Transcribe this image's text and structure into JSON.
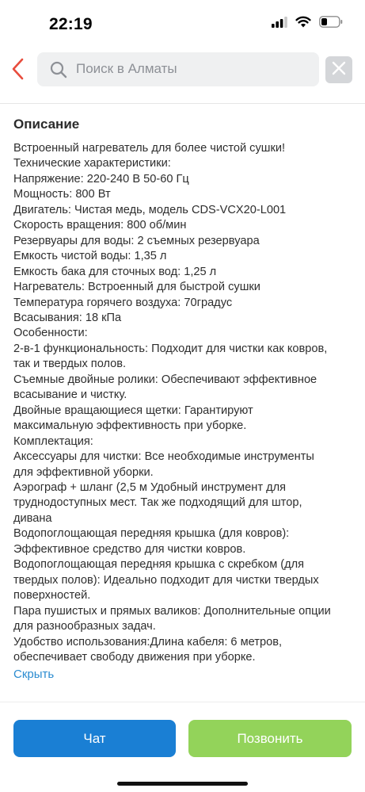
{
  "status_bar": {
    "time": "22:19"
  },
  "header": {
    "search_placeholder": "Поиск в Алматы"
  },
  "description": {
    "title": "Описание",
    "lines": [
      "Встроенный нагреватель для более чистой сушки!",
      "Технические характеристики:",
      "Напряжение: 220-240 В 50-60 Гц",
      "Мощность: 800 Вт",
      "Двигатель: Чистая медь, модель CDS-VCX20-L001",
      "Скорость вращения: 800 об/мин",
      "Резервуары для воды: 2 съемных резервуара",
      "Емкость чистой воды: 1,35 л",
      "Емкость бака для сточных вод: 1,25 л",
      "Нагреватель: Встроенный для быстрой сушки",
      "Температура горячего воздуха: 70градус",
      "Всасывания: 18 кПа",
      "Особенности:",
      "2-в-1 функциональность: Подходит для чистки как ковров,",
      "так и твердых полов.",
      "Съемные двойные ролики: Обеспечивают эффективное",
      "всасывание и чистку.",
      "Двойные вращающиеся щетки: Гарантируют",
      "максимальную эффективность при уборке.",
      "Комплектация:",
      "Аксессуары для чистки: Все необходимые инструменты",
      "для эффективной уборки.",
      "Аэрограф + шланг (2,5 м Удобный инструмент для",
      "труднодоступных мест. Так же подходящий для штор,",
      "дивана",
      "Водопоглощающая передняя крышка (для ковров):",
      "Эффективное средство для чистки ковров.",
      "Водопоглощающая передняя крышка с скребком (для",
      "твердых полов): Идеально подходит для чистки твердых",
      "поверхностей.",
      "Пара пушистых и прямых валиков: Дополнительные опции",
      "для разнообразных задач.",
      "Удобство использования:Длина кабеля: 6 метров,",
      "обеспечивает свободу движения при уборке."
    ],
    "collapse_label": "Скрыть"
  },
  "actions": {
    "chat_label": "Чат",
    "call_label": "Позвонить"
  },
  "colors": {
    "accent_red": "#e84c3d",
    "link_blue": "#2a8bd0",
    "chat_blue": "#1a7fd4",
    "call_green": "#93d35a"
  },
  "icons": {
    "back": "chevron-left-icon",
    "search": "search-icon",
    "clear": "close-icon",
    "signal": "cellular-signal-icon",
    "wifi": "wifi-icon",
    "battery": "battery-icon"
  }
}
